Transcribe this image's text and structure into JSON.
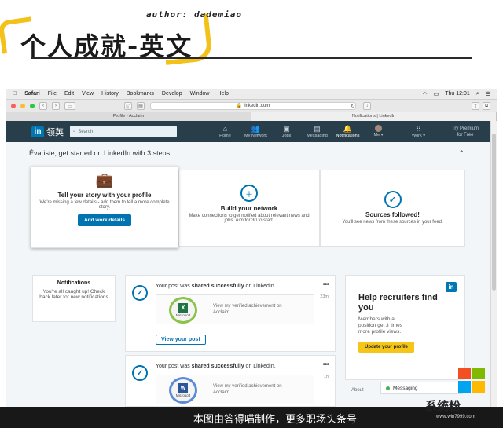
{
  "banner": {
    "author": "author: dademiao",
    "headline": "个人成就-英文"
  },
  "menubar": {
    "items": [
      "Safari",
      "File",
      "Edit",
      "View",
      "History",
      "Bookmarks",
      "Develop",
      "Window",
      "Help"
    ],
    "clock": "Thu 12:01"
  },
  "toolbar": {
    "url": "linkedin.com"
  },
  "tabs": [
    "Profile - Acclaim",
    "Notifications | LinkedIn"
  ],
  "nav": {
    "logo": "in",
    "logo_text": "领英",
    "search_placeholder": "Search",
    "items": [
      {
        "label": "Home",
        "icon": "home-icon"
      },
      {
        "label": "My Network",
        "icon": "network-icon"
      },
      {
        "label": "Jobs",
        "icon": "jobs-icon"
      },
      {
        "label": "Messaging",
        "icon": "messaging-icon"
      },
      {
        "label": "Notifications",
        "icon": "bell-icon"
      },
      {
        "label": "Me ▾",
        "icon": "avatar"
      },
      {
        "label": "Work ▾",
        "icon": "grid-icon"
      }
    ],
    "premium_line1": "Try Premium",
    "premium_line2": "for Free"
  },
  "onboarding": {
    "title": "Évariste, get started on LinkedIn with 3 steps:",
    "cards": [
      {
        "title": "Tell your story with your profile",
        "text": "We're missing a few details - add them to tell a more complete story.",
        "button": "Add work details"
      },
      {
        "title": "Build your network",
        "text": "Make connections to get notified about relevant news and jobs. Aim for 30 to start."
      },
      {
        "title": "Sources followed!",
        "text": "You'll see news from these sources in your feed."
      }
    ]
  },
  "notifications_panel": {
    "title": "Notifications",
    "text": "You're all caught up! Check back later for new notifications"
  },
  "feed": [
    {
      "msg_pre": "Your post was ",
      "msg_bold": "shared successfully",
      "msg_post": " on LinkedIn.",
      "time": "23m",
      "badge_letter": "X",
      "badge_color": "#217346",
      "badge_label": "Microsoft",
      "inner_text": "View my verified achievement on Acclaim.",
      "button": "View your post"
    },
    {
      "msg_pre": "Your post was ",
      "msg_bold": "shared successfully",
      "msg_post": " on LinkedIn.",
      "time": "1h",
      "badge_letter": "W",
      "badge_color": "#2b579a",
      "badge_label": "Microsoft",
      "inner_text": "View my verified achievement on Acclaim."
    }
  ],
  "promo": {
    "logo": "in",
    "title": "Help recruiters find you",
    "text": "Members with a position get 3 times more profile views.",
    "button": "Update your profile"
  },
  "footer": {
    "about": "About",
    "messaging": "Messaging"
  },
  "watermark": {
    "text": "本图由答得喵制作，更多职场头条号",
    "site": "系统粉",
    "site_url": "www.win7999.com"
  }
}
